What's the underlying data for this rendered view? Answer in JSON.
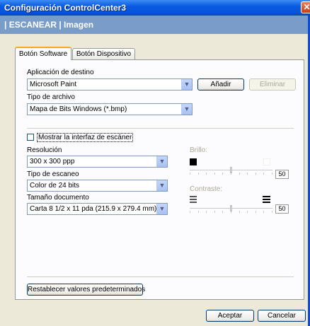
{
  "window": {
    "title": "Configuración ControlCenter3",
    "close_glyph": "✕"
  },
  "header": {
    "text": "| ESCANEAR | Imagen"
  },
  "tabs": [
    {
      "label": "Botón Software",
      "active": true
    },
    {
      "label": "Botón Dispositivo",
      "active": false
    }
  ],
  "destino": {
    "label": "Aplicación de destino",
    "value": "Microsoft Paint",
    "add_label": "Añadir",
    "remove_label": "Eliminar"
  },
  "tipo_archivo": {
    "label": "Tipo de archivo",
    "value": "Mapa de Bits Windows (*.bmp)"
  },
  "interfaz": {
    "label": "Mostrar la interfaz de escáner",
    "checked": false
  },
  "resolucion": {
    "label": "Resolución",
    "value": "300 x 300 ppp"
  },
  "tipo_escaneo": {
    "label": "Tipo de escaneo",
    "value": "Color de 24 bits"
  },
  "tamano": {
    "label": "Tamaño documento",
    "value": "Carta 8 1/2 x 11 pda (215.9 x 279.4 mm)"
  },
  "brillo": {
    "label": "Brillo:",
    "value": "50",
    "level": 0.5
  },
  "contraste": {
    "label": "Contraste:",
    "value": "50",
    "level": 0.5
  },
  "reset_label": "Restablecer valores predeterminados",
  "footer": {
    "ok_label": "Aceptar",
    "cancel_label": "Cancelar"
  },
  "icons": {
    "dropdown": "chevron-down-icon",
    "close": "close-icon",
    "brightness_low": "black-square-icon",
    "brightness_high": "white-square-icon",
    "contrast_low": "low-contrast-icon",
    "contrast_high": "high-contrast-icon"
  }
}
